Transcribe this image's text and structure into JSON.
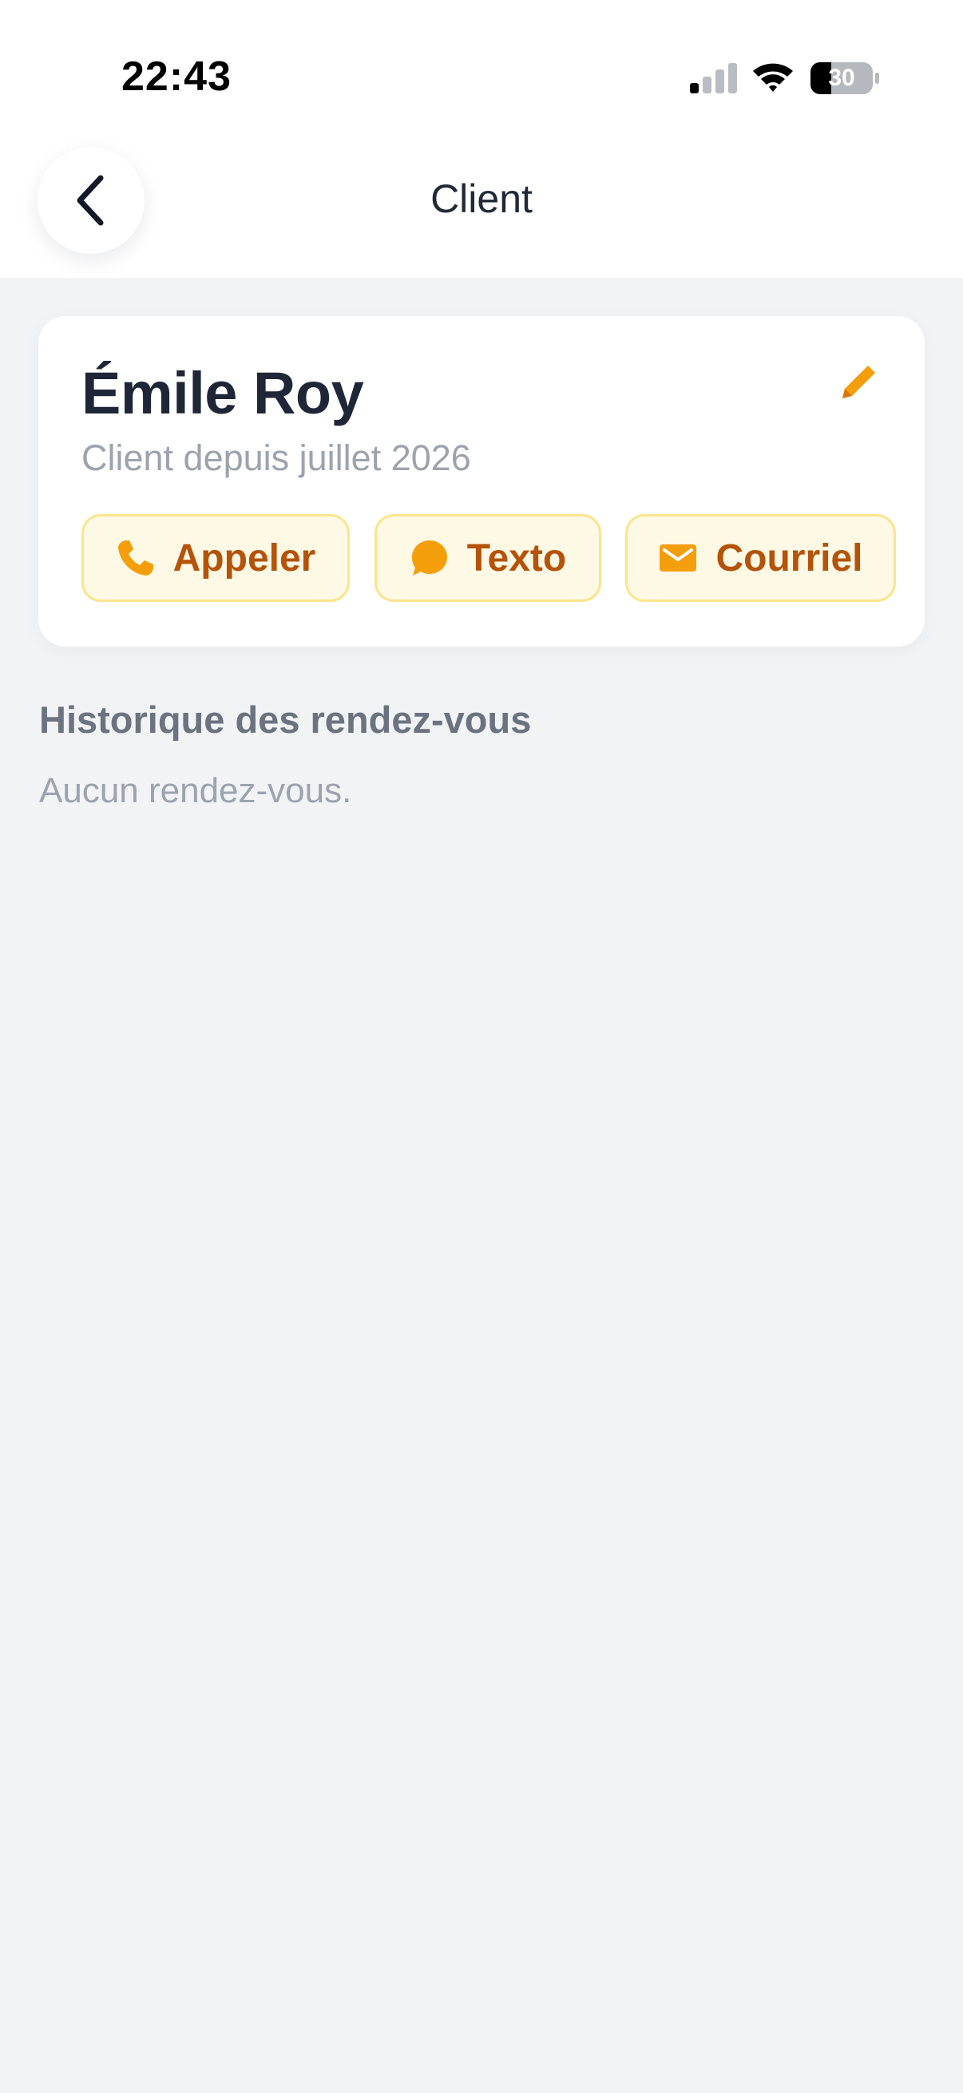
{
  "status_bar": {
    "time": "22:43",
    "battery_level": "30",
    "icons": [
      "signal-icon",
      "wifi-icon",
      "battery-icon"
    ]
  },
  "nav": {
    "title": "Client",
    "back_icon": "chevron-left-icon"
  },
  "client": {
    "name": "Émile Roy",
    "since": "Client depuis juillet 2026",
    "edit_icon": "pencil-icon"
  },
  "actions": [
    {
      "label": "Appeler",
      "icon": "phone-icon"
    },
    {
      "label": "Texto",
      "icon": "chat-bubble-icon"
    },
    {
      "label": "Courriel",
      "icon": "mail-icon"
    }
  ],
  "history": {
    "title": "Historique des rendez-vous",
    "empty_text": "Aucun rendez-vous."
  },
  "colors": {
    "accent": "#f59e0b",
    "accent_text": "#b45309",
    "chip_background": "#fef9e5",
    "chip_border": "#fbe48e",
    "page_background": "#f2f3f5"
  }
}
